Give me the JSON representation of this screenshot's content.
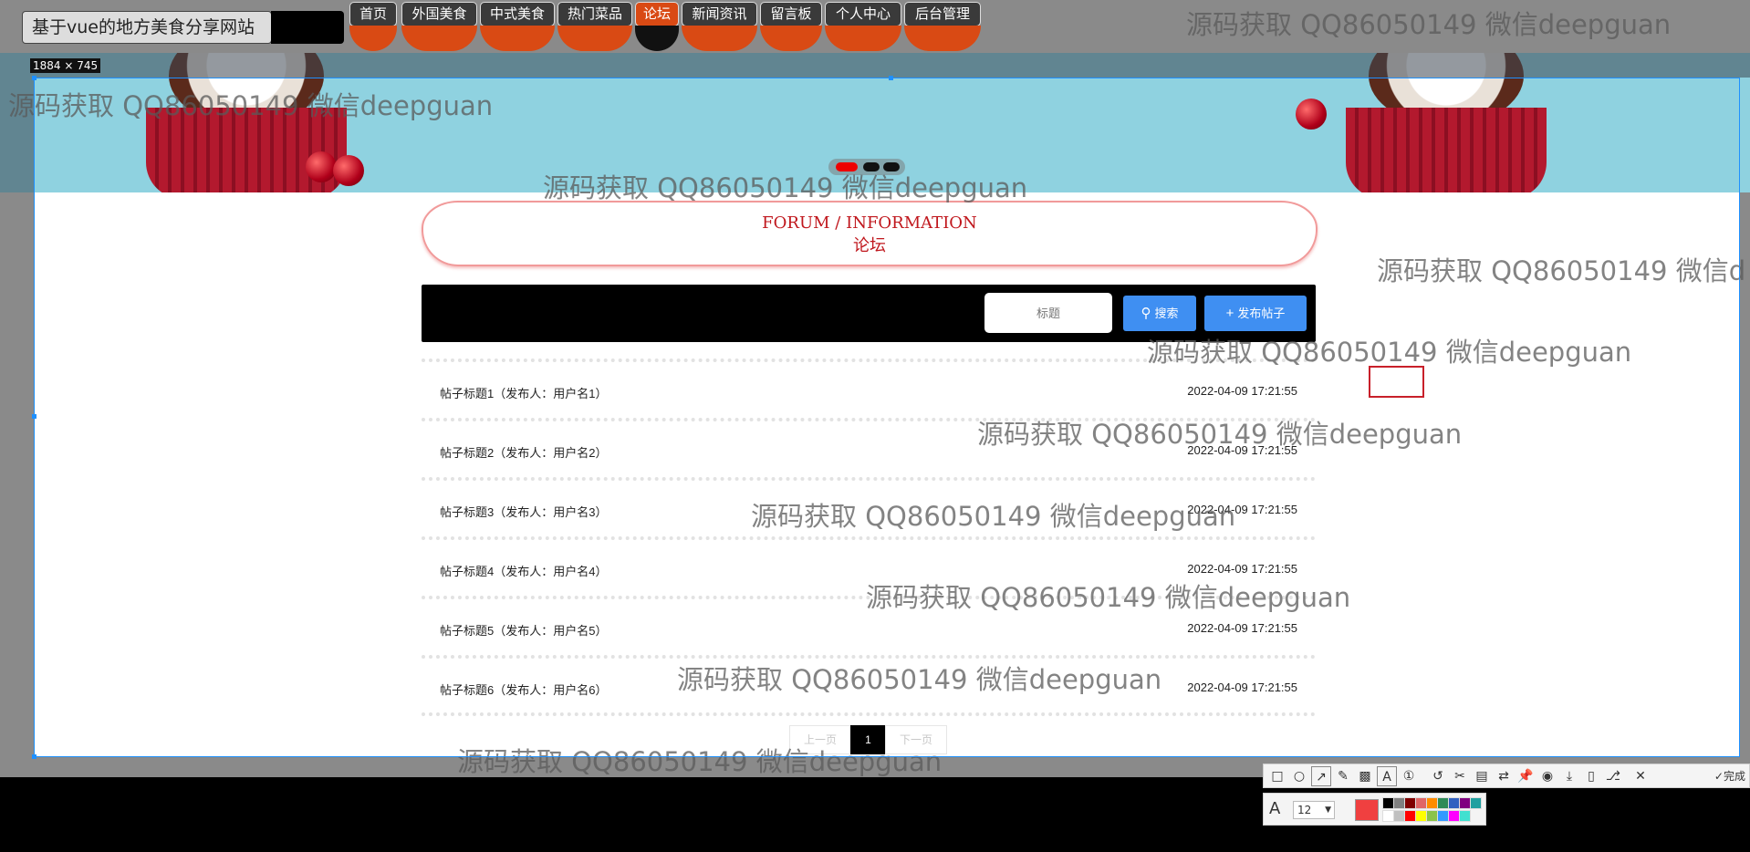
{
  "site_title": "基于vue的地方美食分享网站",
  "nav": [
    {
      "label": "首页",
      "active": false
    },
    {
      "label": "外国美食",
      "active": false
    },
    {
      "label": "中式美食",
      "active": false
    },
    {
      "label": "热门菜品",
      "active": false
    },
    {
      "label": "论坛",
      "active": true
    },
    {
      "label": "新闻资讯",
      "active": false
    },
    {
      "label": "留言板",
      "active": false
    },
    {
      "label": "个人中心",
      "active": false
    },
    {
      "label": "后台管理",
      "active": false
    }
  ],
  "selection_size_label": "1884 × 745",
  "forum": {
    "title_en": "FORUM / INFORMATION",
    "title_cn": "论坛",
    "search_placeholder": "标题",
    "search_label": "搜索",
    "post_label": "发布帖子",
    "posts": [
      {
        "title": "帖子标题1（发布人：用户名1）",
        "date": "2022-04-09 17:21:55"
      },
      {
        "title": "帖子标题2（发布人：用户名2）",
        "date": "2022-04-09 17:21:55"
      },
      {
        "title": "帖子标题3（发布人：用户名3）",
        "date": "2022-04-09 17:21:55"
      },
      {
        "title": "帖子标题4（发布人：用户名4）",
        "date": "2022-04-09 17:21:55"
      },
      {
        "title": "帖子标题5（发布人：用户名5）",
        "date": "2022-04-09 17:21:55"
      },
      {
        "title": "帖子标题6（发布人：用户名6）",
        "date": "2022-04-09 17:21:55"
      }
    ],
    "pagination": {
      "prev": "上一页",
      "current": "1",
      "next": "下一页"
    }
  },
  "watermark": "源码获取 QQ86050149 微信deepguan",
  "watermark_cut": "源码获取 QQ86050149 微信d",
  "annotation_toolbar": {
    "done_label": "完成",
    "font_size": "12",
    "current_color": "#f04040",
    "palette": [
      "#000000",
      "#808080",
      "#800000",
      "#e06666",
      "#ff8c00",
      "#2e8b57",
      "#3060c0",
      "#800080",
      "#20a0a0",
      "#ffffff",
      "#c0c0c0",
      "#ff0000",
      "#ffff00",
      "#8bc34a",
      "#3399ff",
      "#ff00ff",
      "#40e0d0"
    ]
  }
}
